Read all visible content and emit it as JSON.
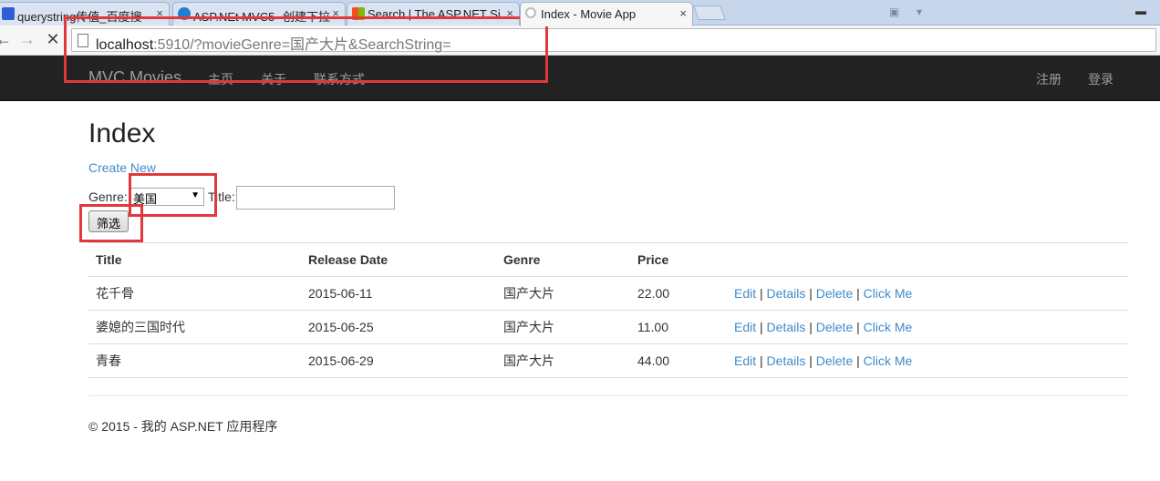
{
  "browser": {
    "tabs": [
      {
        "label": "querystring传值_百度搜",
        "favicon_color": "#2f5fd6"
      },
      {
        "label": "ASP.NEt MVC5--创建下拉",
        "favicon_color": "#1c7fd1"
      },
      {
        "label": "Search | The ASP.NET Si",
        "favicon_color": "#e94e1b"
      },
      {
        "label": "Index - Movie App",
        "favicon_color": "#cccccc"
      }
    ],
    "tab_close": "×",
    "url_host": "localhost",
    "url_rest": ":5910/?movieGenre=国产大片&SearchString="
  },
  "navbar": {
    "brand": "MVC Movies",
    "links": [
      "主页",
      "关于",
      "联系方式"
    ],
    "right_links": [
      "注册",
      "登录"
    ]
  },
  "page": {
    "title": "Index",
    "create_link": "Create New",
    "genre_label": "Genre:",
    "genre_selected": "美国",
    "title_label": "Title:",
    "title_value": "",
    "filter_button": "筛选"
  },
  "table": {
    "headers": [
      "Title",
      "Release Date",
      "Genre",
      "Price"
    ],
    "rows": [
      {
        "title": "花千骨",
        "date": "2015-06-11",
        "genre": "国产大片",
        "price": "22.00"
      },
      {
        "title": "婆媳的三国时代",
        "date": "2015-06-25",
        "genre": "国产大片",
        "price": "11.00"
      },
      {
        "title": "青春",
        "date": "2015-06-29",
        "genre": "国产大片",
        "price": "44.00"
      }
    ],
    "actions": {
      "edit": "Edit",
      "details": "Details",
      "delete": "Delete",
      "click": "Click Me",
      "separator": "|"
    }
  },
  "footer": "© 2015 - 我的 ASP.NET 应用程序",
  "colors": {
    "annotation": "#e0383c",
    "link": "#428bca",
    "navbar": "#222222"
  }
}
